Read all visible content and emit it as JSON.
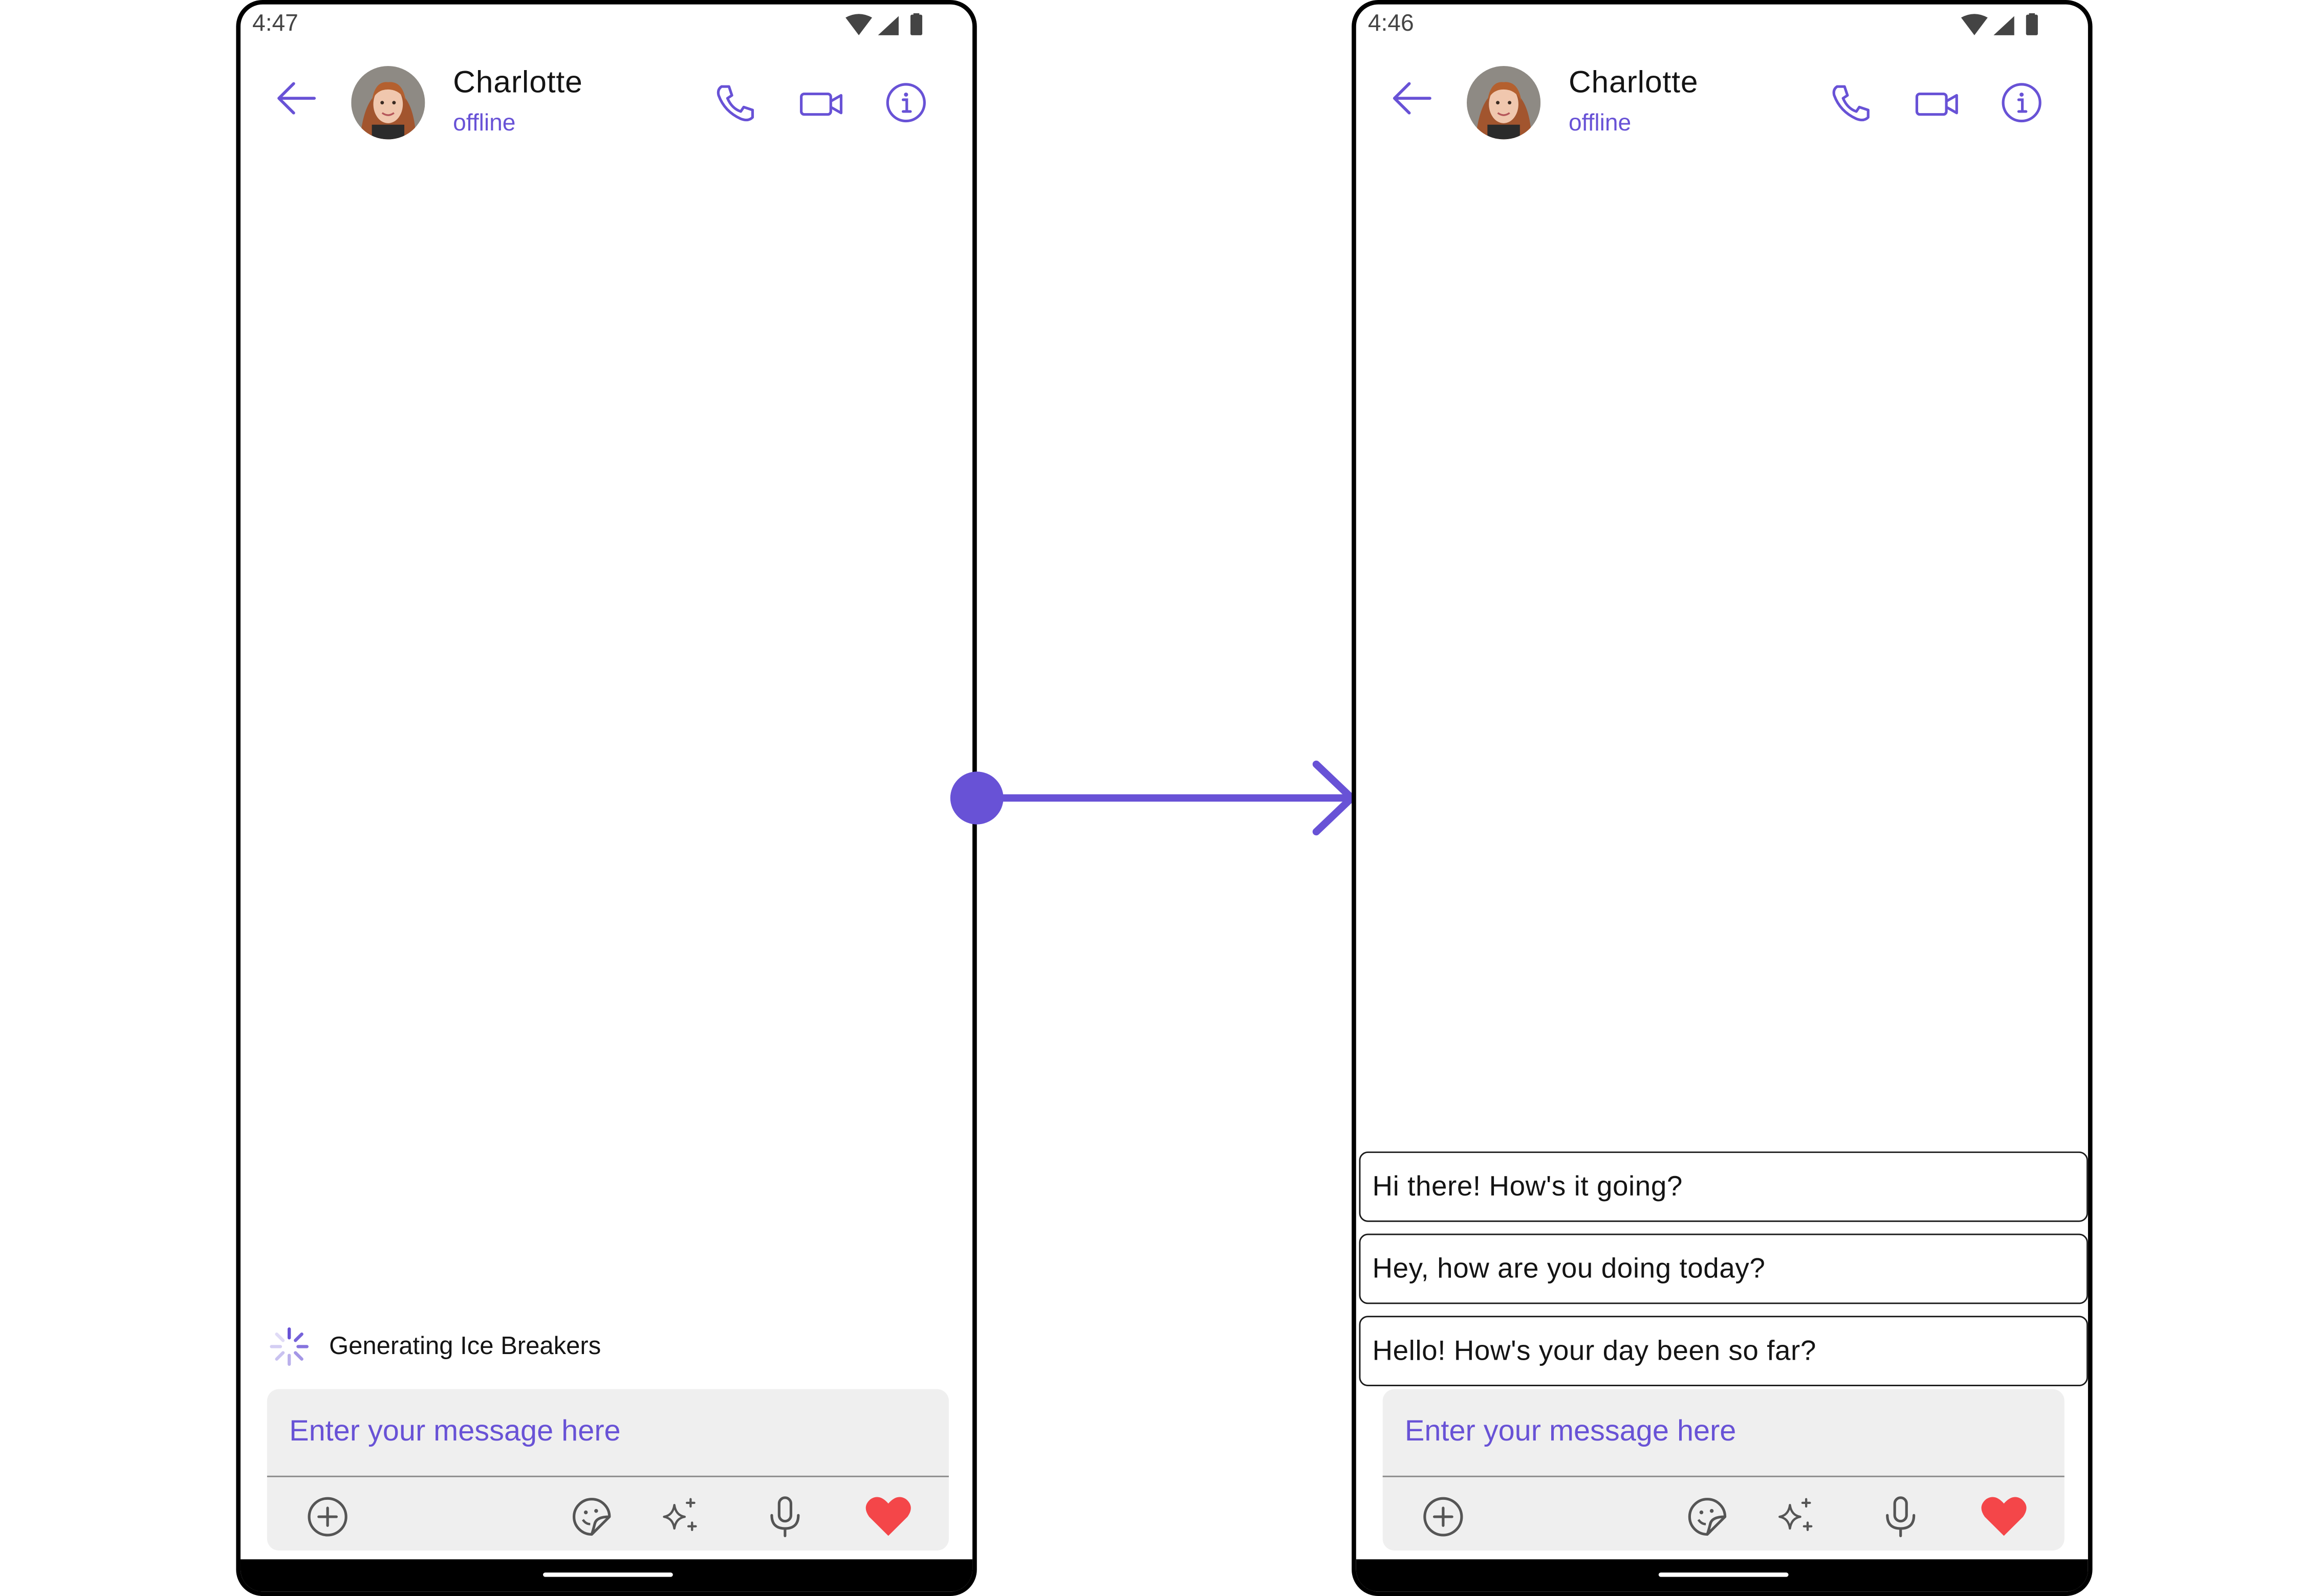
{
  "colors": {
    "accent": "#6852d6",
    "text_primary": "#141414",
    "composer_bg": "#efefef",
    "heart": "#f44649"
  },
  "left_screen": {
    "status_bar": {
      "time": "4:47"
    },
    "header": {
      "contact_name": "Charlotte",
      "contact_status": "offline"
    },
    "generating_label": "Generating Ice Breakers",
    "composer": {
      "placeholder": "Enter your message here"
    }
  },
  "right_screen": {
    "status_bar": {
      "time": "4:46"
    },
    "header": {
      "contact_name": "Charlotte",
      "contact_status": "offline"
    },
    "ice_breakers": [
      "Hi there! How's it going?",
      "Hey, how are you doing today?",
      "Hello! How's your day been so far?"
    ],
    "composer": {
      "placeholder": "Enter your message here"
    }
  },
  "icons": [
    "back-arrow-icon",
    "voice-call-icon",
    "video-call-icon",
    "info-icon",
    "add-attachment-icon",
    "sticker-icon",
    "ai-sparkle-icon",
    "microphone-icon",
    "heart-icon",
    "loading-spinner-icon",
    "wifi-icon",
    "signal-icon",
    "battery-icon"
  ]
}
